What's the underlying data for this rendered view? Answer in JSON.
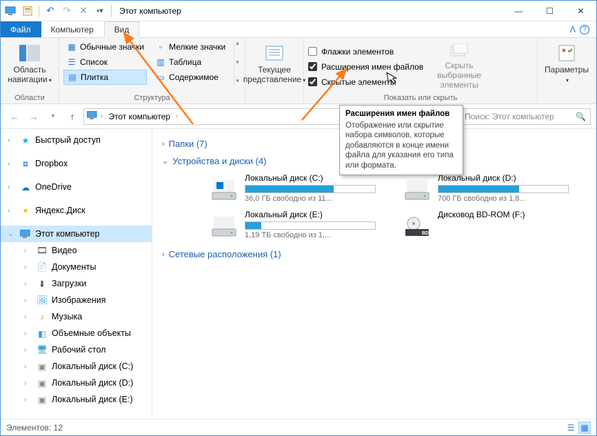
{
  "title": "Этот компьютер",
  "menu": {
    "file": "Файл",
    "computer": "Компьютер",
    "view": "Вид"
  },
  "ribbon": {
    "nav_area": "Область навигации",
    "nav_group": "Области",
    "layout": {
      "huge": "Обычные значки",
      "small": "Мелкие значки",
      "list": "Список",
      "table": "Таблица",
      "tiles": "Плитка",
      "content": "Содержимое",
      "group": "Структура"
    },
    "current_view": "Текущее представление",
    "checks": {
      "flags": "Флажки элементов",
      "ext": "Расширения имен файлов",
      "hidden": "Скрытые элементы"
    },
    "hide_selected_1": "Скрыть выбранные",
    "hide_selected_2": "элементы",
    "show_hide_group": "Показать или скрыть",
    "params": "Параметры"
  },
  "address": {
    "crumb": "Этот компьютер"
  },
  "search": {
    "placeholder": "Поиск: Этот компьютер"
  },
  "sidebar": {
    "quick": "Быстрый доступ",
    "dropbox": "Dropbox",
    "onedrive": "OneDrive",
    "yandex": "Яндекс.Диск",
    "thispc": "Этот компьютер",
    "video": "Видео",
    "docs": "Документы",
    "downloads": "Загрузки",
    "images": "Изображения",
    "music": "Музыка",
    "objects3d": "Объемные объекты",
    "desktop": "Рабочий стол",
    "diskc": "Локальный диск (C:)",
    "diskd": "Локальный диск (D:)",
    "diske": "Локальный диск (E:)"
  },
  "content": {
    "folders": "Папки (7)",
    "drives_head": "Устройства и диски (4)",
    "network": "Сетевые расположения (1)",
    "drives": [
      {
        "name": "Локальный диск (C:)",
        "free": "36,0 ГБ свободно из 11...",
        "fill": 68
      },
      {
        "name": "Локальный диск (D:)",
        "free": "700 ГБ свободно из 1,8...",
        "fill": 62
      },
      {
        "name": "Локальный диск (E:)",
        "free": "1,19 ТБ свободно из 1,...",
        "fill": 12
      },
      {
        "name": "Дисковод BD-ROM (F:)",
        "free": "",
        "fill": -1
      }
    ]
  },
  "tooltip": {
    "title": "Расширения имен файлов",
    "body": "Отображение или скрытие набора символов, которые добавляются в конце имени файла для указания его типа или формата."
  },
  "status": {
    "items": "Элементов: 12"
  }
}
